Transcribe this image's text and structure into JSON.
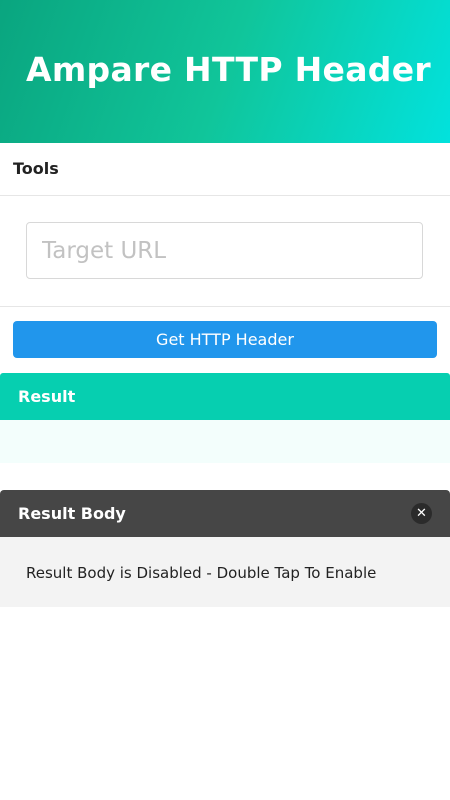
{
  "header": {
    "title": "Ampare HTTP Header"
  },
  "tools": {
    "label": "Tools"
  },
  "url_input": {
    "placeholder": "Target URL",
    "value": ""
  },
  "get_button": {
    "label": "Get HTTP Header"
  },
  "result": {
    "title": "Result",
    "content": ""
  },
  "result_body": {
    "title": "Result Body",
    "close_icon": "close-icon",
    "message": "Result Body is Disabled - Double Tap To Enable"
  },
  "colors": {
    "header_gradient_start": "#0aa57f",
    "header_gradient_end": "#02e2dd",
    "button": "#2196ec",
    "result_header": "#06cfb0",
    "result_body_header": "#464646"
  }
}
